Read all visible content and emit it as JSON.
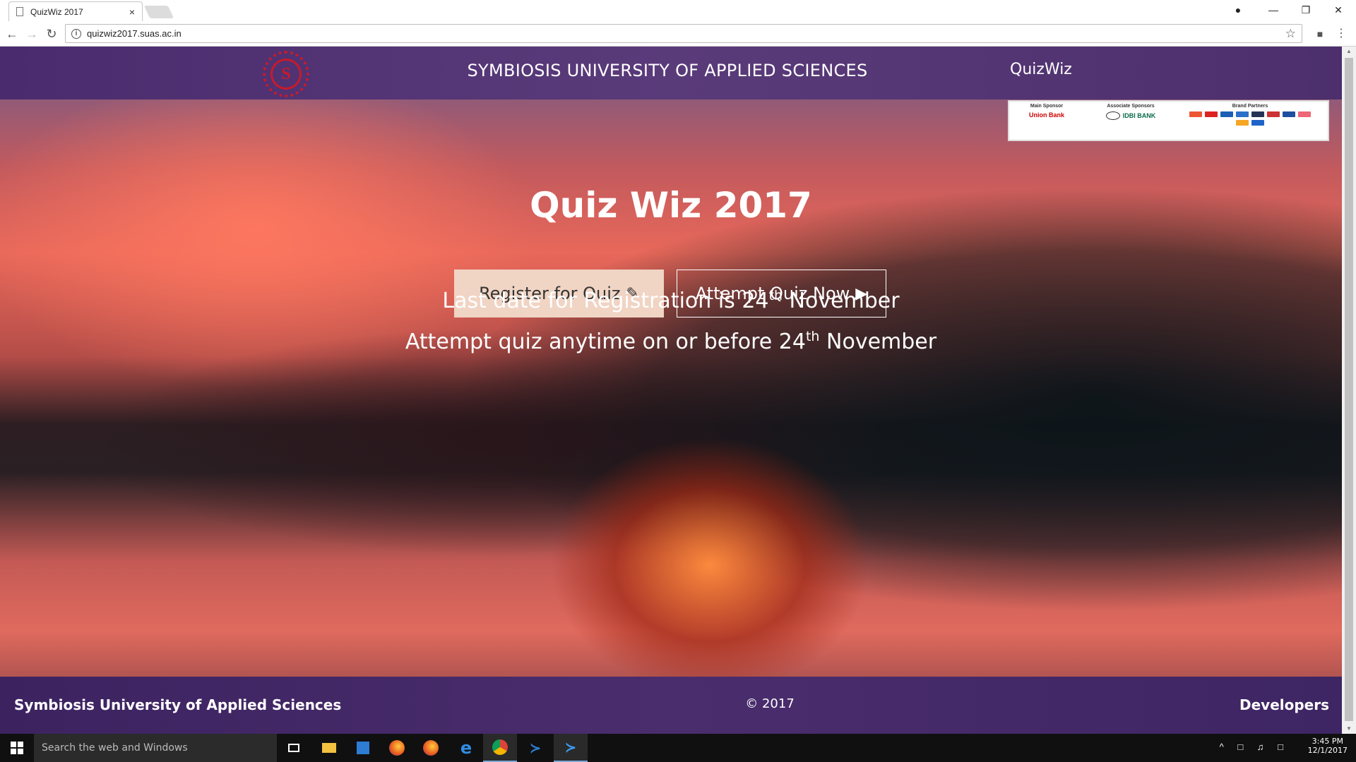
{
  "browser": {
    "tab_title": "QuizWiz 2017",
    "tab_close": "×",
    "url": "quizwiz2017.suas.ac.in"
  },
  "header": {
    "logo_letter": "S",
    "university": "SYMBIOSIS UNIVERSITY OF APPLIED SCIENCES",
    "brand": "QuizWiz"
  },
  "sponsors": {
    "main_heading": "Main Sponsor",
    "main_logo": "Union Bank",
    "associate_heading": "Associate Sponsors",
    "associate_logo": "IDBI BANK",
    "brand_heading": "Brand Partners"
  },
  "hero": {
    "title": "Quiz Wiz 2017",
    "register_label": "Register for Quiz",
    "attempt_label": "Attempt Quiz Now",
    "line1_prefix": "Last date for Registration is 24",
    "line1_sup": "th",
    "line1_suffix": " November",
    "line2_prefix": "Attempt quiz anytime on or before 24",
    "line2_sup": "th",
    "line2_suffix": " November"
  },
  "footer": {
    "left": "Symbiosis University of Applied Sciences",
    "center": "© 2017",
    "right": "Developers"
  },
  "taskbar": {
    "search_placeholder": "Search the web and Windows",
    "time": "3:45 PM",
    "date": "12/1/2017"
  },
  "colors": {
    "header_purple": "#4a2c6e",
    "register_bg": "#f0d4c4",
    "logo_red": "#c81a2a"
  }
}
